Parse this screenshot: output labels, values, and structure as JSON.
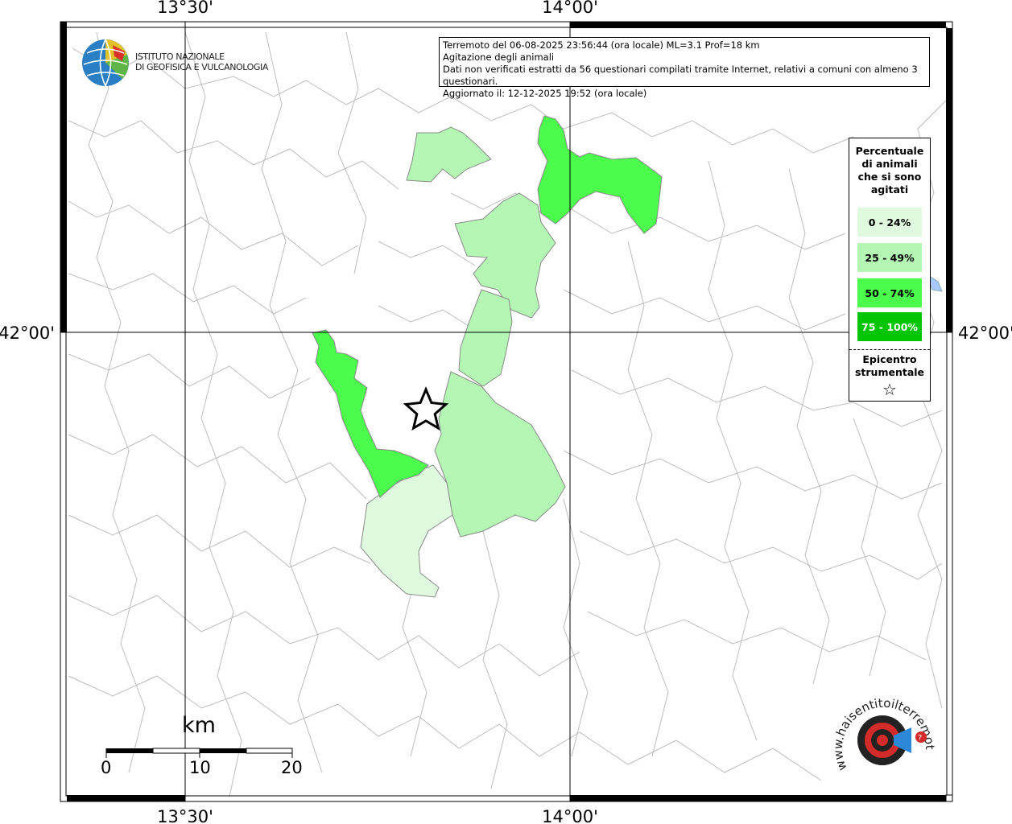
{
  "header": {
    "line1": "Terremoto del 06-08-2025 23:56:44 (ora locale) ML=3.1 Prof=18 km",
    "line2": "Agitazione degli animali",
    "line3": "Dati non verificati estratti da 56 questionari compilati tramite Internet, relativi a comuni con almeno 3 questionari.",
    "line4": "Aggiornato il: 12-12-2025 19:52 (ora locale)"
  },
  "logo": {
    "name": "ingv-globe-icon",
    "line1": "ISTITUTO NAZIONALE",
    "line2": "DI GEOFISICA E VULCANOLOGIA"
  },
  "axes": {
    "top_ticks": [
      "13°30'",
      "14°00'"
    ],
    "bottom_ticks": [
      "13°30'",
      "14°00'"
    ],
    "left_tick": "42°00'",
    "right_tick": "42°00'"
  },
  "legend": {
    "title": "Percentuale di animali che si sono agitati",
    "items": [
      {
        "label": "0 - 24%",
        "color": "#e0fae0"
      },
      {
        "label": "25 - 49%",
        "color": "#b4f7b4"
      },
      {
        "label": "50 - 74%",
        "color": "#4cfc4c"
      },
      {
        "label": "75 - 100%",
        "color": "#03c503"
      }
    ],
    "epicenter_label": "Epicentro strumentale",
    "epicenter_icon": "star-icon"
  },
  "scale": {
    "unit": "km",
    "labels": [
      "0",
      "10",
      "20"
    ]
  },
  "watermark": {
    "icon": "haisentito-logo-icon",
    "text": "www.haisentitoilterremoto.it"
  }
}
